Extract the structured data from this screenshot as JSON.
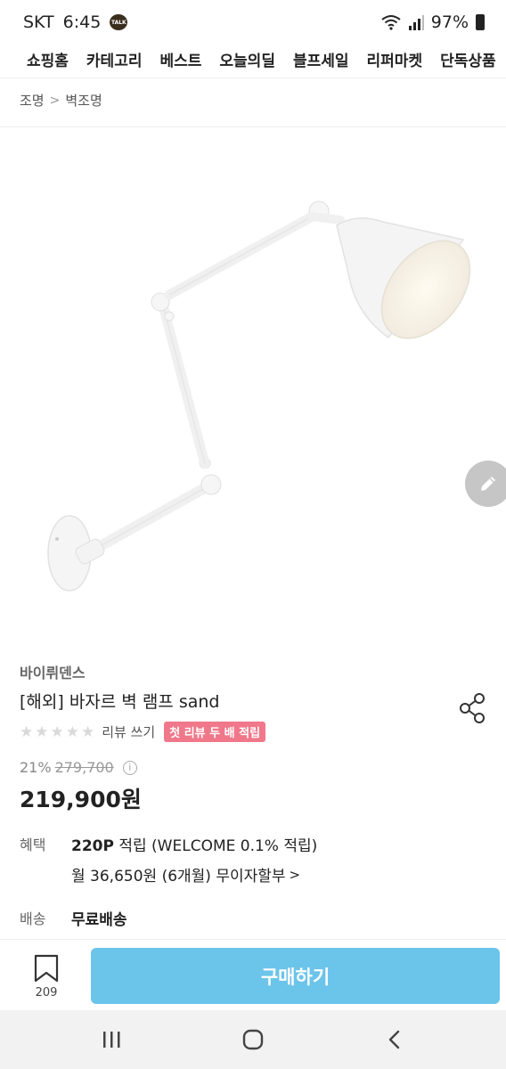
{
  "status_bar": {
    "carrier": "SKT",
    "time": "6:45",
    "talk_badge": "TALK",
    "battery": "97%"
  },
  "category_nav": {
    "items": [
      "쇼핑홈",
      "카테고리",
      "베스트",
      "오늘의딜",
      "블프세일",
      "리퍼마켓",
      "단독상품"
    ]
  },
  "breadcrumb": {
    "level1": "조명",
    "separator": ">",
    "level2": "벽조명"
  },
  "product": {
    "brand": "바이뤼덴스",
    "title": "[해외] 바자르 벽 램프 sand",
    "rating": {
      "value": 0,
      "max": 5
    },
    "review_link": "리뷰 쓰기",
    "first_review_badge": "첫 리뷰 두 배 적립",
    "discount_rate": "21%",
    "original_price": "279,700",
    "price": "219,900원"
  },
  "benefits": {
    "label": "혜택",
    "points_amount": "220P",
    "points_text": "적립 (WELCOME 0.1% 적립)",
    "installment": "월 36,650원 (6개월) 무이자할부",
    "installment_chevron": ">"
  },
  "shipping": {
    "label": "배송",
    "value": "무료배송"
  },
  "bottom_bar": {
    "bookmark_count": "209",
    "buy_label": "구매하기"
  },
  "colors": {
    "buy_button": "#6bc4ea",
    "badge": "#f0788a",
    "edit_fab": "#c6c6c6"
  },
  "icons": {
    "talk": "kakaotalk-icon",
    "wifi": "wifi-icon",
    "signal": "signal-icon",
    "battery": "battery-icon",
    "edit": "pencil-icon",
    "share": "share-icon",
    "bookmark": "bookmark-icon",
    "info": "info-icon",
    "recent_apps": "recent-apps-icon",
    "home": "home-icon",
    "back": "back-icon"
  }
}
